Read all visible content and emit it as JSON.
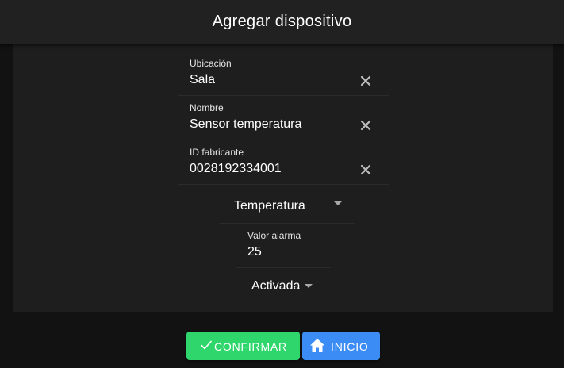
{
  "dialog": {
    "title": "Agregar dispositivo"
  },
  "form": {
    "fields": [
      {
        "label": "Ubicación",
        "value": "Sala"
      },
      {
        "label": "Nombre",
        "value": "Sensor temperatura"
      },
      {
        "label": "ID fabricante",
        "value": "0028192334001"
      }
    ],
    "type_select": {
      "value": "Temperatura"
    },
    "alarm_value": {
      "label": "Valor alarma",
      "value": "25"
    },
    "status_select": {
      "value": "Activada"
    }
  },
  "actions": {
    "confirm_label": "CONFIRMAR",
    "home_label": "INICIO"
  },
  "colors": {
    "confirm": "#2fd66b",
    "home": "#3b8cf5",
    "header": "#212121",
    "card": "#1e1e1e"
  },
  "icons": {
    "clear": "close-icon",
    "dropdown": "caret-down-icon",
    "confirm": "check-icon",
    "home": "home-icon"
  }
}
